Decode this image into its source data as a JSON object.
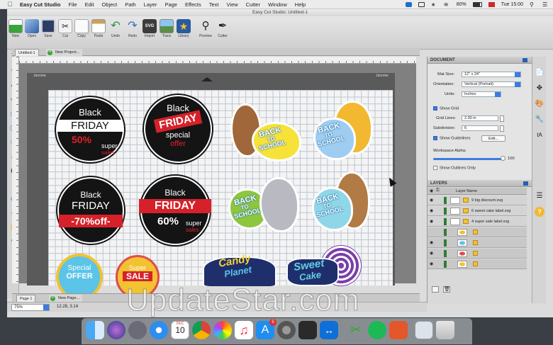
{
  "menubar": {
    "app_name": "Easy Cut Studio",
    "items": [
      "File",
      "Edit",
      "Object",
      "Path",
      "Layer",
      "Page",
      "Effects",
      "Text",
      "View",
      "Cutter",
      "Window",
      "Help"
    ],
    "battery": "80%",
    "clock": "Tue 15:00"
  },
  "window": {
    "title": "Easy Cut Studio: Untitled-1"
  },
  "toolbar": {
    "buttons": [
      {
        "label": "New",
        "icon": "new-icon",
        "color": "#3aa43a"
      },
      {
        "label": "Open",
        "icon": "open-icon",
        "color": "#3b6fb5"
      },
      {
        "label": "Save",
        "icon": "save-icon",
        "color": "#2d3e66"
      },
      {
        "label": "Cut",
        "icon": "scissors-icon",
        "color": "#8a8a8a"
      },
      {
        "label": "Copy",
        "icon": "copy-icon",
        "color": "#bbbbbb"
      },
      {
        "label": "Paste",
        "icon": "paste-icon",
        "color": "#c9a25a"
      },
      {
        "label": "Undo",
        "icon": "undo-icon",
        "color": "#2f8f3a"
      },
      {
        "label": "Redo",
        "icon": "redo-icon",
        "color": "#2f6fbf"
      },
      {
        "label": "Import",
        "icon": "import-svg-icon",
        "color": "#3c3c3c"
      },
      {
        "label": "Trace",
        "icon": "trace-icon",
        "color": "#5a8f4a"
      },
      {
        "label": "Library",
        "icon": "library-icon",
        "color": "#d8b53a"
      },
      {
        "label": "Preview",
        "icon": "magnifier-icon",
        "color": "#d0d0d0"
      },
      {
        "label": "Cutter",
        "icon": "cutter-icon",
        "color": "#555555"
      }
    ]
  },
  "tabs": {
    "doc_tab": "Untitled-1",
    "new_project": "New Project..."
  },
  "mat": {
    "left_label": "Janome",
    "right_label": "Janome"
  },
  "stickers": {
    "bf1": {
      "l1": "Black",
      "l2": "FRIDAY",
      "l3": "50%",
      "l4": "super",
      "l5": "sales"
    },
    "bf2": {
      "l1": "Black",
      "l2": "FRIDAY",
      "l3": "special",
      "l4": "offer"
    },
    "bf3": {
      "l1": "Black",
      "l2": "FRIDAY",
      "l3": "-70%off-"
    },
    "bf4": {
      "l1": "Black",
      "l2": "FRIDAY",
      "l3": "60%",
      "l4": "super",
      "l5": "sales"
    },
    "so": {
      "l1": "Special",
      "l2": "OFFER"
    },
    "ss": {
      "l1": "Super",
      "l2": "SALE"
    },
    "back": {
      "l1": "BACK",
      "l2": "TO",
      "l3": "SCHOOL"
    },
    "candy": {
      "l1": "Candy",
      "l2": "Planet"
    },
    "sweet": {
      "l1": "Sweet",
      "l2": "Cake"
    }
  },
  "pagebar": {
    "page_tab": "Page 1",
    "new_page": "New Page..."
  },
  "status": {
    "zoom": "75%",
    "coords": "12.28, 3.14"
  },
  "document_panel": {
    "header": "DOCUMENT",
    "mat_size_label": "Mat Size:",
    "mat_size": "12\" x 24\"",
    "orientation_label": "Orientation:",
    "orientation": "Vertical (Portrait)",
    "units_label": "Units:",
    "units": "Inches",
    "show_grid": "Show Grid",
    "grid_lines_label": "Grid Lines:",
    "grid_lines": "2.00 in",
    "subdivision_label": "Subdivision:",
    "subdivision": "6",
    "show_guidelines": "Show Guidelines",
    "edit_button": "Edit...",
    "workspace_alpha_label": "Workspace Alpha:",
    "workspace_alpha": "100",
    "show_outlines": "Show Outlines Only"
  },
  "layers_panel": {
    "header": "LAYERS",
    "column": "Layer Name",
    "rows": [
      {
        "name": "9 big discount.svg"
      },
      {
        "name": "6 sweet cake label.svg"
      },
      {
        "name": "4 super sale label.svg"
      }
    ]
  },
  "watermark": "UpdateStar.com",
  "dock": {
    "calendar_month": "DEC",
    "calendar_day": "10",
    "badge": "5"
  }
}
